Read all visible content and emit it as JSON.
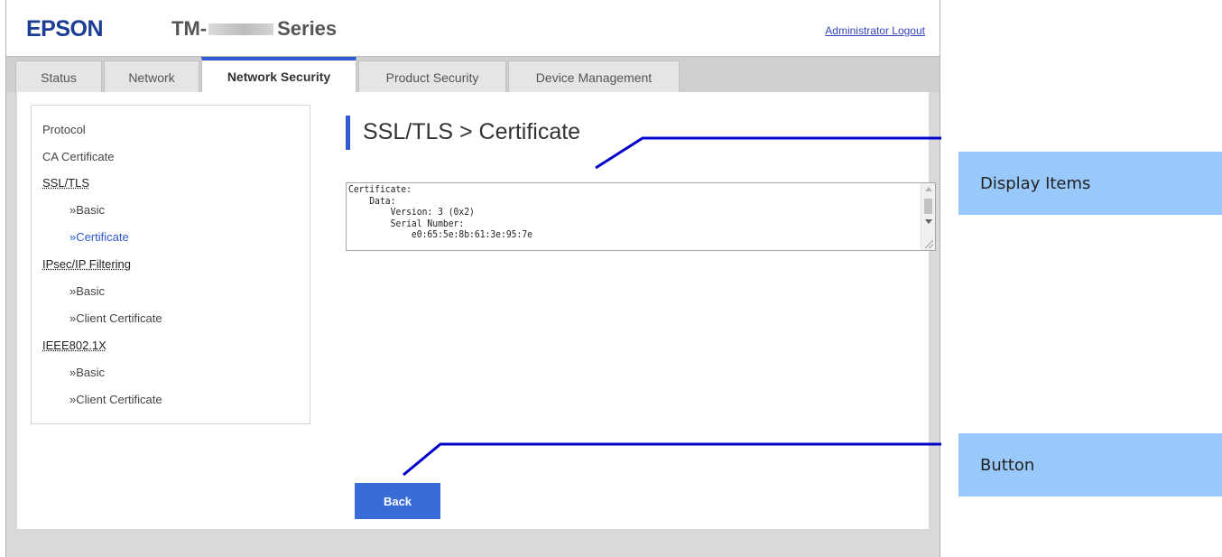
{
  "header": {
    "brand": "EPSON",
    "model_prefix": "TM-",
    "model_suffix": "Series",
    "logout_label": "Administrator Logout"
  },
  "tabs": [
    "Status",
    "Network",
    "Network Security",
    "Product Security",
    "Device Management"
  ],
  "active_tab": "Network Security",
  "sidebar": {
    "items": [
      {
        "label": "Protocol"
      },
      {
        "label": "CA Certificate"
      },
      {
        "label": "SSL/TLS"
      },
      {
        "label": "»Basic"
      },
      {
        "label": "»Certificate"
      },
      {
        "label": "IPsec/IP Filtering"
      },
      {
        "label": "»Basic"
      },
      {
        "label": "»Client Certificate"
      },
      {
        "label": "IEEE802.1X"
      },
      {
        "label": "»Basic"
      },
      {
        "label": "»Client Certificate"
      }
    ]
  },
  "main": {
    "title": "SSL/TLS > Certificate",
    "certificate_text": "Certificate:\n    Data:\n        Version: 3 (0x2)\n        Serial Number:\n            e0:65:5e:8b:61:3e:95:7e",
    "back_label": "Back"
  },
  "annotations": {
    "display_items": "Display Items",
    "button": "Button",
    "line_color": "#0000cc",
    "box_color": "#99c8fb"
  },
  "colors": {
    "accent": "#2f5ad0",
    "brand": "#1b3d94",
    "button": "#3a6cd8"
  }
}
